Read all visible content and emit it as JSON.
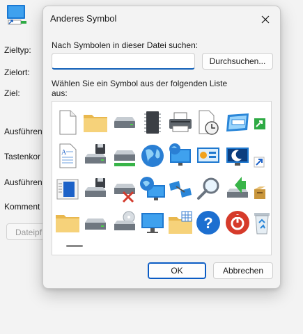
{
  "background": {
    "labels": [
      "Zieltyp:",
      "Zielort:",
      "Ziel:",
      "Ausführen",
      "Tastenkor",
      "Ausführen",
      "Komment"
    ],
    "button_label": "Dateipf"
  },
  "dialog": {
    "title": "Anderes Symbol",
    "search_label": "Nach Symbolen in dieser Datei suchen:",
    "search_value": "",
    "browse_label": "Durchsuchen...",
    "list_label_1": "Wählen Sie ein Symbol aus der folgenden Liste",
    "list_label_2": "aus:",
    "ok_label": "OK",
    "cancel_label": "Abbrechen"
  },
  "icons": [
    [
      "blank-file-icon",
      "folder-icon",
      "drive-icon",
      "chip-icon",
      "printer-icon",
      "clock-file-icon",
      "window-icon",
      "shortcut-arrow-icon"
    ],
    [
      "document-icon",
      "floppy-drive-icon",
      "network-drive-icon",
      "globe-icon",
      "monitor-globe-icon",
      "control-panel-icon",
      "moon-icon",
      "shortcut-overlay-icon"
    ],
    [
      "notepad-icon",
      "drive-floppy-icon",
      "drive-disconnected-icon",
      "globe-monitor-icon",
      "network-icon",
      "search-icon",
      "install-arrow-icon",
      "box-icon"
    ],
    [
      "folder-open-icon",
      "drive-plain-icon",
      "cd-drive-icon",
      "monitor-icon",
      "folder-grid-icon",
      "help-icon",
      "power-icon",
      "recycle-bin-icon"
    ]
  ],
  "colors": {
    "accent": "#0a5bc4",
    "folder": "#f5c96a",
    "drive": "#9aa3ab"
  }
}
